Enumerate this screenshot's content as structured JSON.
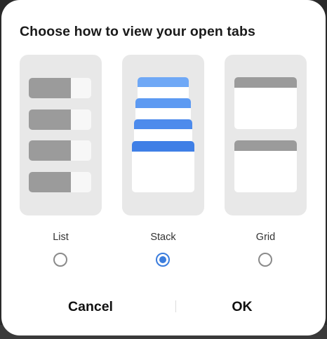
{
  "dialog": {
    "title": "Choose how to view your open tabs"
  },
  "options": [
    {
      "id": "list",
      "label": "List",
      "selected": false
    },
    {
      "id": "stack",
      "label": "Stack",
      "selected": true
    },
    {
      "id": "grid",
      "label": "Grid",
      "selected": false
    }
  ],
  "buttons": {
    "cancel": "Cancel",
    "ok": "OK"
  },
  "colors": {
    "accent": "#3b7ddd",
    "card_background": "#e8e8e8",
    "thumbnail_gray": "#9b9b9b",
    "stack_bar_light": "#6fa8f6",
    "stack_bar_mid": "#5592ef",
    "stack_bar_dark": "#3f7fe6"
  }
}
